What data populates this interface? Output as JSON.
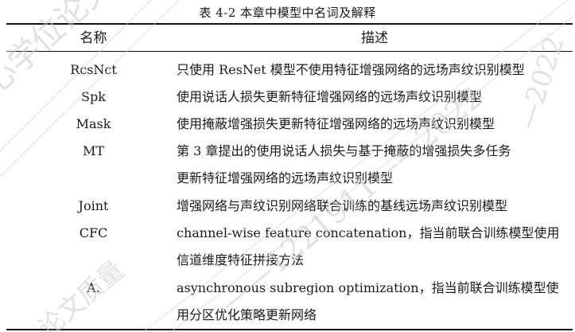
{
  "table": {
    "caption": "表 4-2 本章中模型中名词及解释",
    "headers": {
      "name": "名称",
      "description": "描述"
    },
    "rows": [
      {
        "name": "RcsNct",
        "description": [
          "只使用 ResNet 模型不使用特征增强网络的远场声纹识别模型"
        ]
      },
      {
        "name": "Spk",
        "description": [
          "使用说话人损失更新特征增强网络的远场声纹识别模型"
        ]
      },
      {
        "name": "Mask",
        "description": [
          "使用掩蔽增强损失更新特征增强网络的远场声纹识别模型"
        ]
      },
      {
        "name": "MT",
        "description": [
          "第 3 章提出的使用说话人损失与基于掩蔽的增强损失多任务",
          "更新特征增强网络的远场声纹识别模型"
        ]
      },
      {
        "name": "Joint",
        "description": [
          "增强网络与声纹识别网络联合训练的基线远场声纹识别模型"
        ]
      },
      {
        "name": "CFC",
        "description": [
          "channel-wise feature concatenation，指当前联合训练模型使用",
          "信道维度特征拼接方法"
        ]
      },
      {
        "name": "A.",
        "description": [
          "asynchronous subregion optimization，指当前联合训练模型使",
          "用分区优化策略更新网络"
        ]
      }
    ]
  },
  "watermark": {
    "texts": [
      "心学位论文质量",
      "—2022",
      "——1221911——2022",
      "论文质量"
    ],
    "color": "#d0d0d0"
  }
}
